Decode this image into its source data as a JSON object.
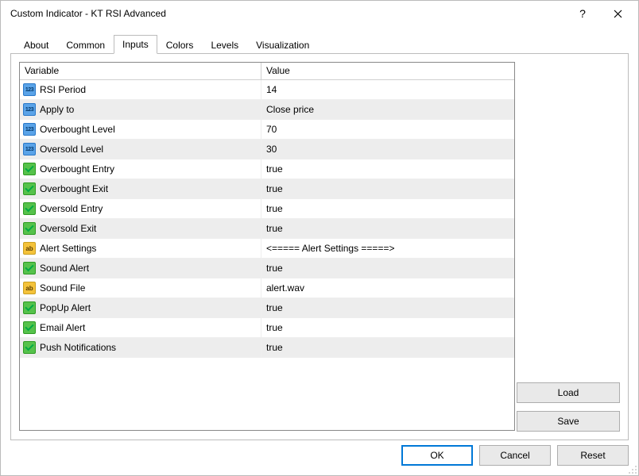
{
  "window": {
    "title": "Custom Indicator - KT RSI Advanced"
  },
  "tabs": {
    "items": [
      {
        "label": "About"
      },
      {
        "label": "Common"
      },
      {
        "label": "Inputs"
      },
      {
        "label": "Colors"
      },
      {
        "label": "Levels"
      },
      {
        "label": "Visualization"
      }
    ],
    "active_index": 2
  },
  "grid": {
    "headers": {
      "variable": "Variable",
      "value": "Value"
    },
    "rows": [
      {
        "icon": "int",
        "variable": "RSI Period",
        "value": "14"
      },
      {
        "icon": "int",
        "variable": "Apply to",
        "value": "Close price"
      },
      {
        "icon": "int",
        "variable": "Overbought Level",
        "value": "70"
      },
      {
        "icon": "int",
        "variable": "Oversold Level",
        "value": "30"
      },
      {
        "icon": "bool",
        "variable": "Overbought Entry",
        "value": "true"
      },
      {
        "icon": "bool",
        "variable": "Overbought Exit",
        "value": "true"
      },
      {
        "icon": "bool",
        "variable": "Oversold Entry",
        "value": "true"
      },
      {
        "icon": "bool",
        "variable": "Oversold Exit",
        "value": "true"
      },
      {
        "icon": "str",
        "variable": "Alert Settings",
        "value": "<===== Alert Settings =====>"
      },
      {
        "icon": "bool",
        "variable": "Sound Alert",
        "value": "true"
      },
      {
        "icon": "str",
        "variable": "Sound File",
        "value": "alert.wav"
      },
      {
        "icon": "bool",
        "variable": "PopUp Alert",
        "value": "true"
      },
      {
        "icon": "bool",
        "variable": "Email Alert",
        "value": "true"
      },
      {
        "icon": "bool",
        "variable": "Push Notifications",
        "value": "true"
      }
    ]
  },
  "side_buttons": {
    "load": "Load",
    "save": "Save"
  },
  "bottom_buttons": {
    "ok": "OK",
    "cancel": "Cancel",
    "reset": "Reset"
  }
}
